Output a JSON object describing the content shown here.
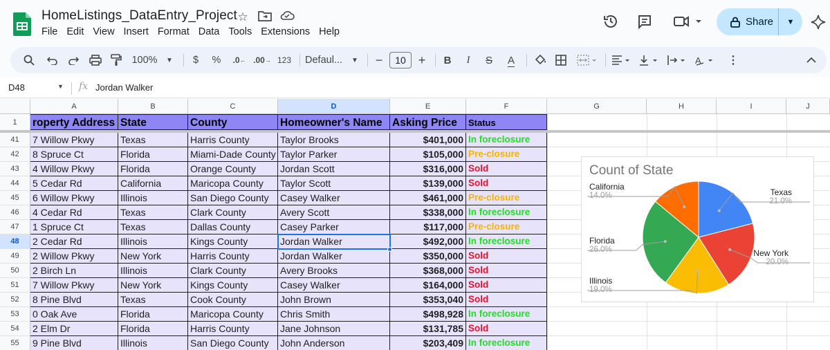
{
  "header": {
    "doc_title": "HomeListings_DataEntry_Project",
    "share_label": "Share",
    "menu": [
      "File",
      "Edit",
      "View",
      "Insert",
      "Format",
      "Data",
      "Tools",
      "Extensions",
      "Help"
    ]
  },
  "toolbar": {
    "zoom": "100%",
    "currency": "$",
    "percent": "%",
    "dec_decrease": ".0",
    "dec_increase": ".00",
    "number_format": "123",
    "font": "Defaul...",
    "font_size": "10",
    "bold": "B",
    "italic": "I",
    "strike": "S",
    "text_color": "A"
  },
  "formula_bar": {
    "cell_ref": "D48",
    "value": "Jordan Walker"
  },
  "columns": [
    "A",
    "B",
    "C",
    "D",
    "E",
    "F",
    "G",
    "H",
    "I",
    "J"
  ],
  "table": {
    "header_row": "1",
    "headers": [
      "roperty Address",
      "State",
      "County",
      "Homeowner's Name",
      "Asking Price",
      "Status"
    ],
    "rows": [
      {
        "n": "41",
        "addr": "7 Willow Pkwy",
        "state": "Texas",
        "county": "Harris County",
        "owner": "Taylor Brooks",
        "price": "$401,000",
        "status": "In foreclosure"
      },
      {
        "n": "42",
        "addr": "8 Spruce Ct",
        "state": "Florida",
        "county": "Miami-Dade County",
        "owner": "Taylor Parker",
        "price": "$105,000",
        "status": "Pre-closure"
      },
      {
        "n": "43",
        "addr": "4 Willow Pkwy",
        "state": "Florida",
        "county": "Orange County",
        "owner": "Jordan Scott",
        "price": "$316,000",
        "status": "Sold"
      },
      {
        "n": "44",
        "addr": "5 Cedar Rd",
        "state": "California",
        "county": "Maricopa County",
        "owner": "Taylor Scott",
        "price": "$139,000",
        "status": "Sold"
      },
      {
        "n": "45",
        "addr": "6 Willow Pkwy",
        "state": "Illinois",
        "county": "San Diego County",
        "owner": "Casey Walker",
        "price": "$461,000",
        "status": "Pre-closure"
      },
      {
        "n": "46",
        "addr": "4 Cedar Rd",
        "state": "Texas",
        "county": "Clark County",
        "owner": "Avery Scott",
        "price": "$338,000",
        "status": "In foreclosure"
      },
      {
        "n": "47",
        "addr": "1 Spruce Ct",
        "state": "Texas",
        "county": "Dallas County",
        "owner": "Casey Parker",
        "price": "$117,000",
        "status": "Pre-closure"
      },
      {
        "n": "48",
        "addr": "2 Cedar Rd",
        "state": "Illinois",
        "county": "Kings County",
        "owner": "Jordan Walker",
        "price": "$492,000",
        "status": "In foreclosure"
      },
      {
        "n": "49",
        "addr": "2 Willow Pkwy",
        "state": "New York",
        "county": "Harris County",
        "owner": "Jordan Walker",
        "price": "$350,000",
        "status": "Sold"
      },
      {
        "n": "50",
        "addr": "2 Birch Ln",
        "state": "Illinois",
        "county": "Clark County",
        "owner": "Avery Brooks",
        "price": "$368,000",
        "status": "Sold"
      },
      {
        "n": "51",
        "addr": "7 Willow Pkwy",
        "state": "New York",
        "county": "Kings County",
        "owner": "Casey Walker",
        "price": "$164,000",
        "status": "Sold"
      },
      {
        "n": "52",
        "addr": "8 Pine Blvd",
        "state": "Texas",
        "county": "Cook County",
        "owner": "John Brown",
        "price": "$353,040",
        "status": "Sold"
      },
      {
        "n": "53",
        "addr": "0 Oak Ave",
        "state": "Florida",
        "county": "Maricopa County",
        "owner": "Chris Smith",
        "price": "$498,928",
        "status": "In foreclosure"
      },
      {
        "n": "54",
        "addr": "2 Elm Dr",
        "state": "Florida",
        "county": "Harris County",
        "owner": "Jane Johnson",
        "price": "$131,785",
        "status": "Sold"
      },
      {
        "n": "55",
        "addr": "9 Pine Blvd",
        "state": "Illinois",
        "county": "San Diego County",
        "owner": "John Anderson",
        "price": "$203,409",
        "status": "In foreclosure"
      }
    ]
  },
  "status_colors": {
    "In foreclosure": "#22dd22",
    "Pre-closure": "#f5b400",
    "Sold": "#e8112d"
  },
  "colors": {
    "header_fill": "#8e86f5",
    "band_fill": "#e6e3fb",
    "accent": "#1a73e8"
  },
  "chart_data": {
    "type": "pie",
    "title": "Count of State",
    "categories": [
      "Texas",
      "New York",
      "Illinois",
      "Florida",
      "California"
    ],
    "values": [
      21.0,
      20.0,
      19.0,
      26.0,
      14.0
    ],
    "labels": [
      "21.0%",
      "20.0%",
      "19.0%",
      "26.0%",
      "14.0%"
    ],
    "colors": [
      "#4285f4",
      "#ea4335",
      "#fbbc04",
      "#34a853",
      "#ff6d01"
    ]
  }
}
